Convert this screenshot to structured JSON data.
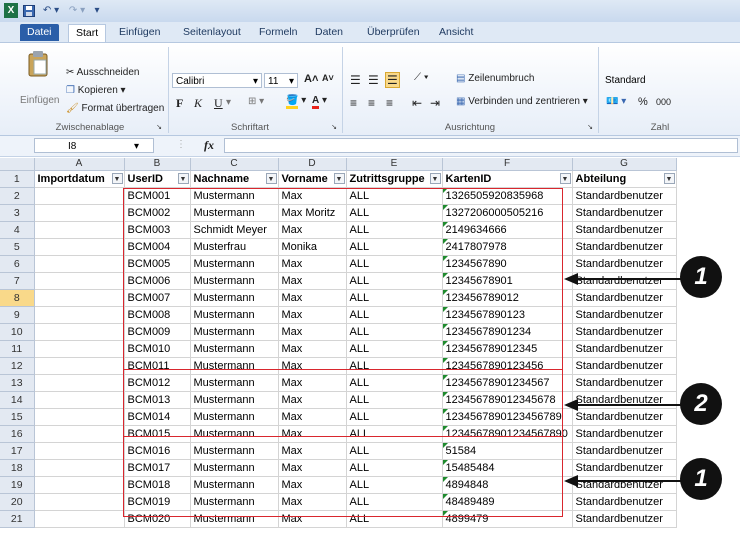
{
  "titlebar": {
    "excel_icon": "X",
    "save_icon": "save-icon",
    "undo_icon": "undo-icon",
    "redo_icon": "redo-icon"
  },
  "tabs": [
    "Datei",
    "Start",
    "Einfügen",
    "Seitenlayout",
    "Formeln",
    "Daten",
    "Überprüfen",
    "Ansicht"
  ],
  "ribbon": {
    "clipboard": {
      "paste": "Einfügen",
      "cut": "Ausschneiden",
      "copy": "Kopieren",
      "format_painter": "Format übertragen",
      "label": "Zwischenablage"
    },
    "font": {
      "name": "Calibri",
      "size": "11",
      "grow": "A˄",
      "shrink": "A˅",
      "bold": "F",
      "italic": "K",
      "underline": "U",
      "label": "Schriftart"
    },
    "alignment": {
      "wrap": "Zeilenumbruch",
      "merge": "Verbinden und zentrieren",
      "label": "Ausrichtung"
    },
    "number": {
      "format": "Standard",
      "percent": "%",
      "thousands": "000",
      "label": "Zahl"
    }
  },
  "formula_bar": {
    "name_box": "I8",
    "fx": "fx",
    "value": ""
  },
  "columns": [
    "A",
    "B",
    "C",
    "D",
    "E",
    "F",
    "G"
  ],
  "headers": [
    "Importdatum",
    "UserID",
    "Nachname",
    "Vorname",
    "Zutrittsgruppe",
    "KartenID",
    "Abteilung"
  ],
  "rows": [
    {
      "n": "2",
      "cells": [
        "",
        "BCM001",
        "Mustermann",
        "Max",
        "ALL",
        "1326505920835968",
        "Standardbenutzer"
      ]
    },
    {
      "n": "3",
      "cells": [
        "",
        "BCM002",
        "Mustermann",
        "Max Moritz",
        "ALL",
        "1327206000505216",
        "Standardbenutzer"
      ]
    },
    {
      "n": "4",
      "cells": [
        "",
        "BCM003",
        "Schmidt Meyer",
        "Max",
        "ALL",
        "2149634666",
        "Standardbenutzer"
      ]
    },
    {
      "n": "5",
      "cells": [
        "",
        "BCM004",
        "Musterfrau",
        "Monika",
        "ALL",
        "2417807978",
        "Standardbenutzer"
      ]
    },
    {
      "n": "6",
      "cells": [
        "",
        "BCM005",
        "Mustermann",
        "Max",
        "ALL",
        "1234567890",
        "Standardbenutzer"
      ]
    },
    {
      "n": "7",
      "cells": [
        "",
        "BCM006",
        "Mustermann",
        "Max",
        "ALL",
        "12345678901",
        "Standardbenutzer"
      ]
    },
    {
      "n": "8",
      "cells": [
        "",
        "BCM007",
        "Mustermann",
        "Max",
        "ALL",
        "123456789012",
        "Standardbenutzer"
      ]
    },
    {
      "n": "9",
      "cells": [
        "",
        "BCM008",
        "Mustermann",
        "Max",
        "ALL",
        "1234567890123",
        "Standardbenutzer"
      ]
    },
    {
      "n": "10",
      "cells": [
        "",
        "BCM009",
        "Mustermann",
        "Max",
        "ALL",
        "12345678901234",
        "Standardbenutzer"
      ]
    },
    {
      "n": "11",
      "cells": [
        "",
        "BCM010",
        "Mustermann",
        "Max",
        "ALL",
        "123456789012345",
        "Standardbenutzer"
      ]
    },
    {
      "n": "12",
      "cells": [
        "",
        "BCM011",
        "Mustermann",
        "Max",
        "ALL",
        "1234567890123456",
        "Standardbenutzer"
      ]
    },
    {
      "n": "13",
      "cells": [
        "",
        "BCM012",
        "Mustermann",
        "Max",
        "ALL",
        "12345678901234567",
        "Standardbenutzer"
      ]
    },
    {
      "n": "14",
      "cells": [
        "",
        "BCM013",
        "Mustermann",
        "Max",
        "ALL",
        "123456789012345678",
        "Standardbenutzer"
      ]
    },
    {
      "n": "15",
      "cells": [
        "",
        "BCM014",
        "Mustermann",
        "Max",
        "ALL",
        "1234567890123456789",
        "Standardbenutzer"
      ]
    },
    {
      "n": "16",
      "cells": [
        "",
        "BCM015",
        "Mustermann",
        "Max",
        "ALL",
        "12345678901234567890",
        "Standardbenutzer"
      ]
    },
    {
      "n": "17",
      "cells": [
        "",
        "BCM016",
        "Mustermann",
        "Max",
        "ALL",
        "51584",
        "Standardbenutzer"
      ]
    },
    {
      "n": "18",
      "cells": [
        "",
        "BCM017",
        "Mustermann",
        "Max",
        "ALL",
        "15485484",
        "Standardbenutzer"
      ]
    },
    {
      "n": "19",
      "cells": [
        "",
        "BCM018",
        "Mustermann",
        "Max",
        "ALL",
        "4894848",
        "Standardbenutzer"
      ]
    },
    {
      "n": "20",
      "cells": [
        "",
        "BCM019",
        "Mustermann",
        "Max",
        "ALL",
        "48489489",
        "Standardbenutzer"
      ]
    },
    {
      "n": "21",
      "cells": [
        "",
        "BCM020",
        "Mustermann",
        "Max",
        "ALL",
        "4899479",
        "Standardbenutzer"
      ]
    }
  ],
  "active_row": "8",
  "callouts": [
    "1",
    "2",
    "1"
  ],
  "colors": {
    "red_box": "#d9272e",
    "file_tab": "#2a5ea8",
    "active_row_header": "#f9d98a",
    "callout": "#111111"
  }
}
